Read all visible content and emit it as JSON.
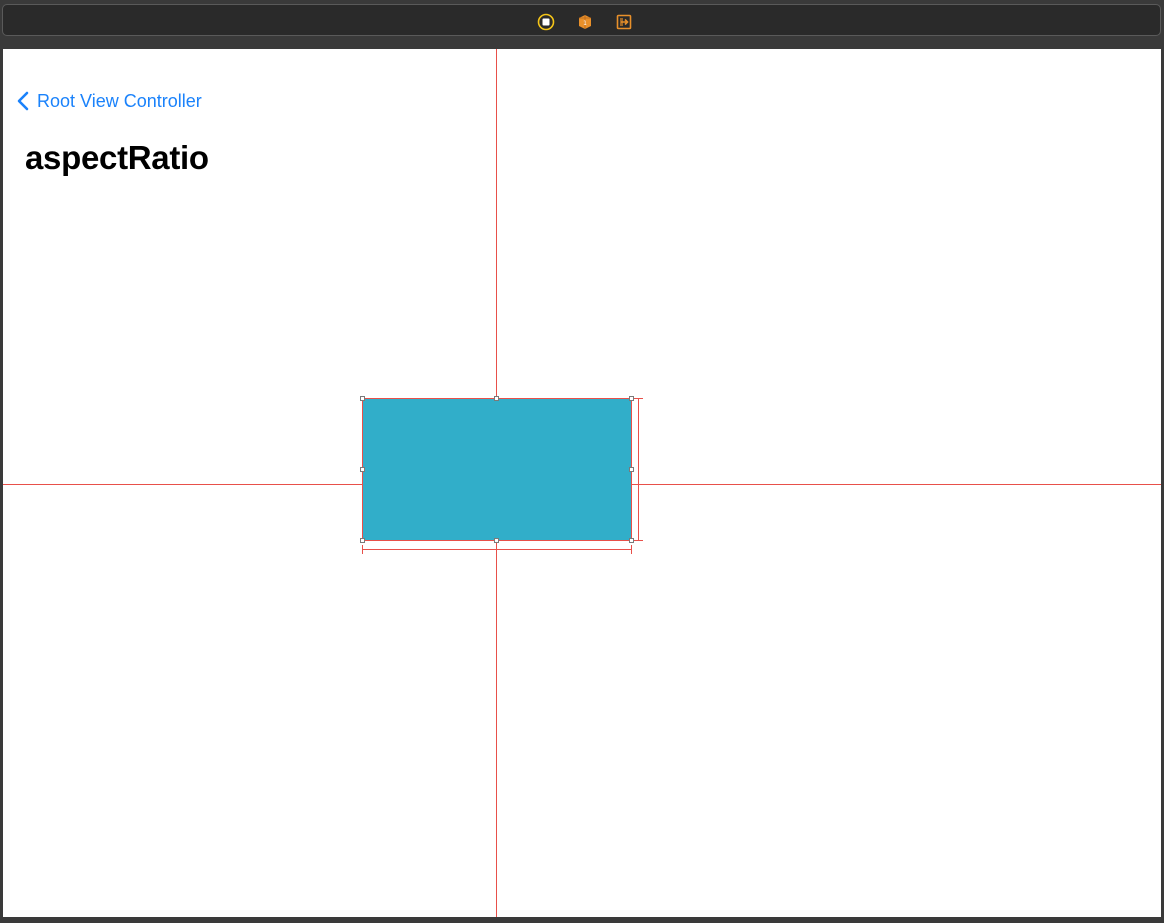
{
  "scene_dock": {
    "icons": [
      {
        "name": "view-controller-icon",
        "color": "#f5c518"
      },
      {
        "name": "first-responder-icon",
        "color": "#e8902a"
      },
      {
        "name": "exit-icon",
        "color": "#e8902a"
      }
    ]
  },
  "navigation_bar": {
    "back_label": "Root View Controller",
    "title": "aspectRatio"
  },
  "colors": {
    "tint": "#1a82fb",
    "view_fill": "#31aec9",
    "constraint": "#e8504a"
  }
}
